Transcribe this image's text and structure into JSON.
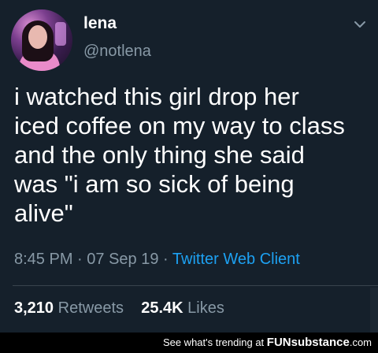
{
  "tweet": {
    "name": "lena",
    "handle": "@notlena",
    "lines": [
      "i watched this girl drop her",
      "iced coffee on my way to class",
      "and the only thing she said",
      "was \"i am so sick of being",
      "alive\""
    ],
    "time": "8:45 PM",
    "date": "07 Sep 19",
    "separator": "·",
    "client": "Twitter Web Client",
    "retweets_count": "3,210",
    "retweets_label": "Retweets",
    "likes_count": "25.4K",
    "likes_label": "Likes"
  },
  "icons": {
    "avatar": "profile-photo",
    "menu": "chevron-down-icon"
  },
  "footer": {
    "text": "See what's trending at",
    "brand": "FUNsubstance",
    "suffix": ".com"
  },
  "colors": {
    "background": "#15202b",
    "secondary_text": "#8899a6",
    "link": "#1da1f2"
  }
}
